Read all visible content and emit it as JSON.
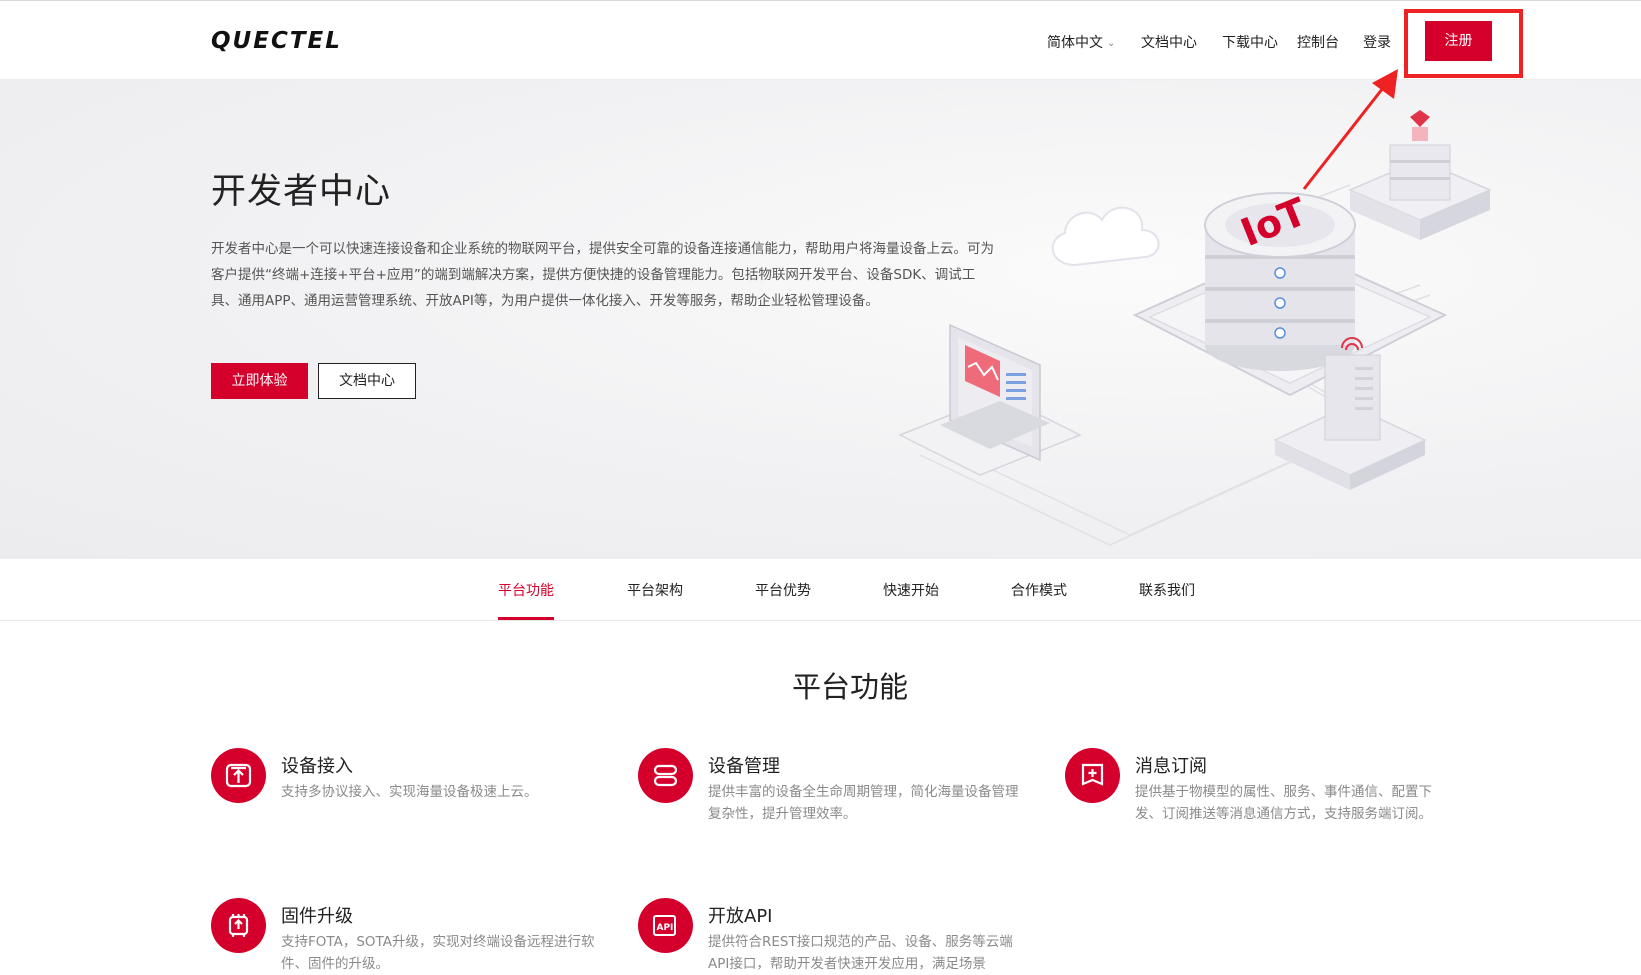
{
  "brand": {
    "logo_text": "QUECTEL",
    "accent_color": "#d4002b",
    "highlight_color": "#ee2222"
  },
  "header": {
    "nav": [
      {
        "label": "简体中文",
        "has_dropdown": true
      },
      {
        "label": "文档中心"
      },
      {
        "label": "下载中心"
      },
      {
        "label": "控制台"
      },
      {
        "label": "登录"
      }
    ],
    "register_label": "注册"
  },
  "hero": {
    "title": "开发者中心",
    "description": "开发者中心是一个可以快速连接设备和企业系统的物联网平台，提供安全可靠的设备连接通信能力，帮助用户将海量设备上云。可为客户提供“终端+连接+平台+应用”的端到端解决方案，提供方便快捷的设备管理能力。包括物联网开发平台、设备SDK、调试工具、通用APP、通用运营管理系统、开放API等，为用户提供一体化接入、开发等服务，帮助企业轻松管理设备。",
    "primary_button": "立即体验",
    "secondary_button": "文档中心",
    "illustration_text": "IoT"
  },
  "tabs": [
    {
      "label": "平台功能",
      "active": true
    },
    {
      "label": "平台架构"
    },
    {
      "label": "平台优势"
    },
    {
      "label": "快速开始"
    },
    {
      "label": "合作模式"
    },
    {
      "label": "联系我们"
    }
  ],
  "features_section": {
    "title": "平台功能",
    "items": [
      {
        "icon": "device-access-icon",
        "title": "设备接入",
        "desc": "支持多协议接入、实现海量设备极速上云。"
      },
      {
        "icon": "device-management-icon",
        "title": "设备管理",
        "desc": "提供丰富的设备全生命周期管理，简化海量设备管理复杂性，提升管理效率。"
      },
      {
        "icon": "message-subscribe-icon",
        "title": "消息订阅",
        "desc": "提供基于物模型的属性、服务、事件通信、配置下发、订阅推送等消息通信方式，支持服务端订阅。"
      },
      {
        "icon": "firmware-upgrade-icon",
        "title": "固件升级",
        "desc": "支持FOTA，SOTA升级，实现对终端设备远程进行软件、固件的升级。"
      },
      {
        "icon": "api-icon",
        "title": "开放API",
        "desc": "提供符合REST接口规范的产品、设备、服务等云端API接口，帮助开发者快速开发应用，满足场景"
      }
    ]
  }
}
